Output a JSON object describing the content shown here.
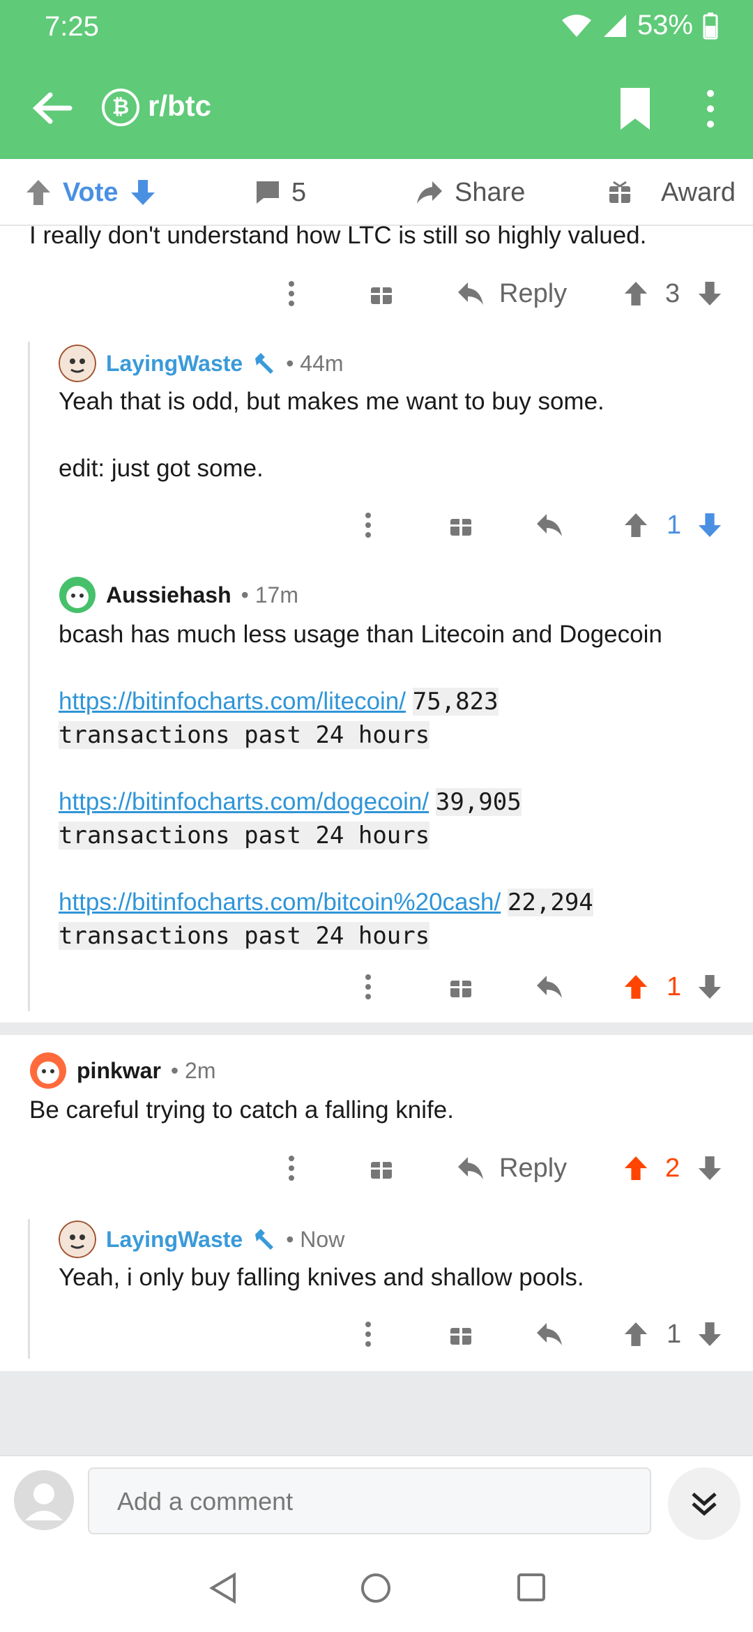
{
  "status": {
    "time": "7:25",
    "battery": "53%"
  },
  "header": {
    "subreddit": "r/btc"
  },
  "action_bar": {
    "vote_label": "Vote",
    "comments_count": "5",
    "share_label": "Share",
    "award_label": "Award"
  },
  "fragment": {
    "text": "I really don't understand how LTC is still so highly valued.",
    "reply_label": "Reply",
    "score": "3"
  },
  "comments": [
    {
      "author": "LayingWaste",
      "time": "• 44m",
      "body_1": "Yeah that is odd, but makes me want to buy some.",
      "body_2": "edit: just got some.",
      "score": "1"
    },
    {
      "author": "Aussiehash",
      "time": "• 17m",
      "body": "bcash has much less usage than Litecoin and Dogecoin",
      "links": [
        {
          "url": "https://bitinfocharts.com/litecoin/",
          "count": "75,823",
          "tail": "transactions past 24 hours"
        },
        {
          "url": "https://bitinfocharts.com/dogecoin/",
          "count": "39,905",
          "tail": "transactions past 24 hours"
        },
        {
          "url": "https://bitinfocharts.com/bitcoin%20cash/",
          "count": "22,294",
          "tail": "transactions past 24 hours"
        }
      ],
      "score": "1"
    },
    {
      "author": "pinkwar",
      "time": "• 2m",
      "body": "Be careful trying to catch a falling knife.",
      "reply_label": "Reply",
      "score": "2"
    },
    {
      "author": "LayingWaste",
      "time": "• Now",
      "body": "Yeah, i only buy falling knives and shallow pools.",
      "score": "1"
    }
  ],
  "composer": {
    "placeholder": "Add a comment"
  },
  "colors": {
    "header_green": "#5fca78",
    "upvote_orange": "#ff4500",
    "downvote_blue": "#4a90e2",
    "op_blue": "#3a9ad9"
  }
}
